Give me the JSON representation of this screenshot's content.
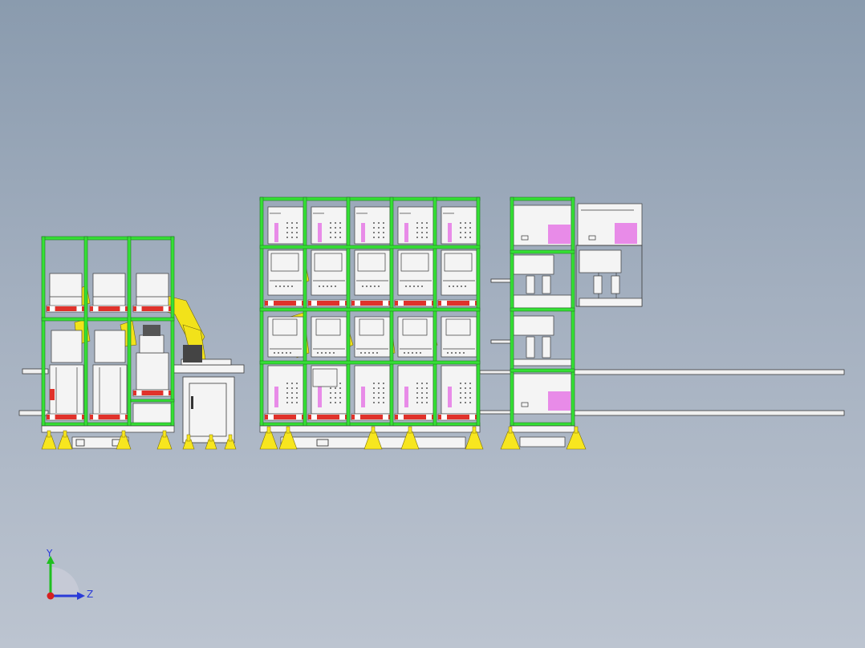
{
  "axes": {
    "y_label": "Y",
    "z_label": "Z"
  },
  "colors": {
    "frame": "#35e035",
    "frame_edge": "#1f7a1f",
    "robot": "#f2e21a",
    "feet": "#f7e61f",
    "tray": "#e0322b",
    "magenta": "#e88be8",
    "outline": "#3a3a3a",
    "panel": "#f4f4f4",
    "rail": "#f0f0f0",
    "axis_y": "#1fbf1f",
    "axis_z": "#2a3bd8",
    "axis_x": "#d62020"
  }
}
